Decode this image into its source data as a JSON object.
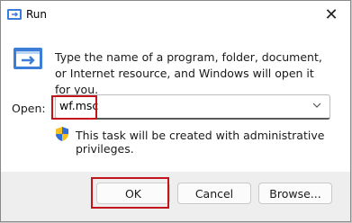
{
  "window": {
    "title": "Run",
    "close_glyph": "✕"
  },
  "content": {
    "description": "Type the name of a program, folder, document, or Internet resource, and Windows will open it for you.",
    "open_label": "Open:",
    "open_value": "wf.msc",
    "admin_note": "This task will be created with administrative privileges."
  },
  "buttons": {
    "ok": "OK",
    "cancel": "Cancel",
    "browse": "Browse..."
  },
  "icons": {
    "title": "run-icon",
    "big": "run-app-icon",
    "shield": "uac-shield-icon",
    "dropdown": "chevron-down-icon",
    "close": "close-icon"
  },
  "colors": {
    "highlight": "#c4141b",
    "footer_bg": "#eeeeee"
  }
}
